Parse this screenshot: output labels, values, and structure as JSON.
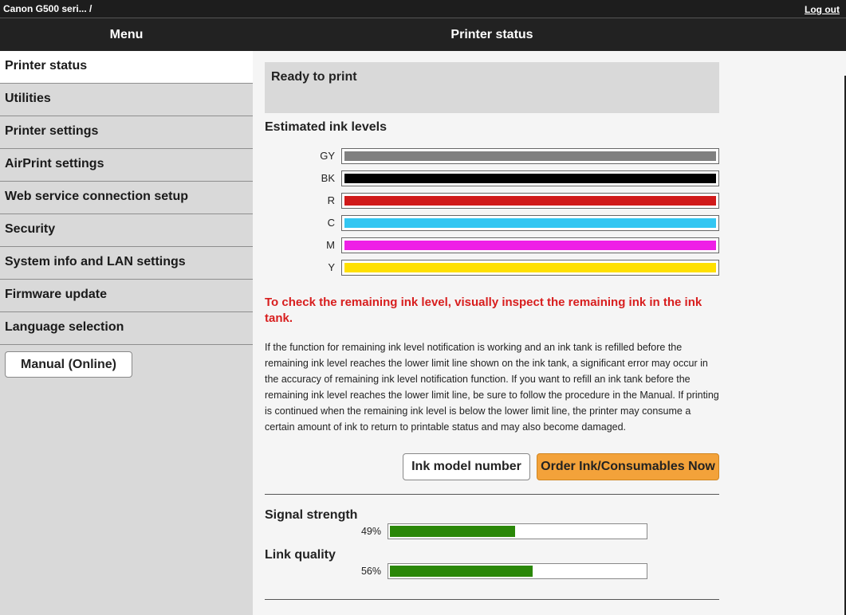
{
  "topbar": {
    "device": "Canon G500 seri... /",
    "logout": "Log out"
  },
  "header": {
    "menu_title": "Menu",
    "page_title": "Printer status"
  },
  "sidebar": {
    "items": [
      {
        "label": "Printer status"
      },
      {
        "label": "Utilities"
      },
      {
        "label": "Printer settings"
      },
      {
        "label": "AirPrint settings"
      },
      {
        "label": "Web service connection setup"
      },
      {
        "label": "Security"
      },
      {
        "label": "System info and LAN settings"
      },
      {
        "label": "Firmware update"
      },
      {
        "label": "Language selection"
      }
    ],
    "manual_button": "Manual (Online)"
  },
  "status": {
    "text": "Ready to print"
  },
  "ink": {
    "title": "Estimated ink levels",
    "levels": [
      {
        "label": "GY",
        "color": "#808080",
        "level": 1.0
      },
      {
        "label": "BK",
        "color": "#000000",
        "level": 1.0
      },
      {
        "label": "R",
        "color": "#d01919",
        "level": 1.0
      },
      {
        "label": "C",
        "color": "#33c6f2",
        "level": 1.0
      },
      {
        "label": "M",
        "color": "#ee1fe6",
        "level": 1.0
      },
      {
        "label": "Y",
        "color": "#ffe000",
        "level": 1.0
      }
    ]
  },
  "warning": "To check the remaining ink level, visually inspect the remaining ink in the ink tank.",
  "notice": "If the function for remaining ink level notification is working and an ink tank is refilled before the remaining ink level reaches the lower limit line shown on the ink tank, a significant error may occur in the accuracy of remaining ink level notification function. If you want to refill an ink tank before the remaining ink level reaches the lower limit line, be sure to follow the procedure in the Manual. If printing is continued when the remaining ink level is below the lower limit line, the printer may consume a certain amount of ink to return to printable status and may also become damaged.",
  "buttons": {
    "ink_model": "Ink model number",
    "order": "Order Ink/Consumables Now"
  },
  "signal": {
    "title": "Signal strength",
    "percent_text": "49%",
    "value": 49
  },
  "link": {
    "title": "Link quality",
    "percent_text": "56%",
    "value": 56
  }
}
